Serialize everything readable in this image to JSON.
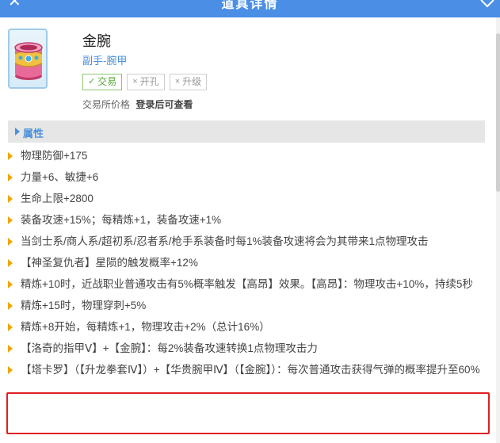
{
  "header": {
    "title": "道具详情",
    "close_icon": "close-icon",
    "favorite_icon": "heart-icon"
  },
  "item": {
    "name": "金腕",
    "category": "副手-腕甲",
    "icon": "bracer-item-icon",
    "tags": [
      {
        "label": "交易",
        "enabled": true
      },
      {
        "label": "开孔",
        "enabled": false
      },
      {
        "label": "升级",
        "enabled": false
      }
    ],
    "price_label": "交易所价格",
    "price_value": "登录后可查看"
  },
  "section": {
    "label": "属性"
  },
  "attributes": [
    "物理防御+175",
    "力量+6、敏捷+6",
    "生命上限+2800",
    "装备攻速+15%；每精炼+1，装备攻速+1%",
    "当剑士系/商人系/超初系/忍者系/枪手系装备时每1%装备攻速将会为其带来1点物理攻击",
    "【神圣复仇者】星陨的触发概率+12%",
    "精炼+10时，近战职业普通攻击有5%概率触发【高昂】效果。【高昂】：物理攻击+10%，持续5秒",
    "精炼+15时，物理穿刺+5%",
    "精炼+8开始，每精炼+1，物理攻击+2%（总计16%）",
    "【洛奇的指甲Ⅴ】+【金腕】：每2%装备攻速转换1点物理攻击力",
    "【塔卡罗】（【升龙拳套Ⅳ】）+【华贵腕甲Ⅳ】（【金腕】）：每次普通攻击获得气弹的概率提升至60%"
  ],
  "colors": {
    "header_bg": "#4a8ee6",
    "accent": "#4a90d9",
    "bullet": "#f0a500",
    "highlight_border": "#e02020",
    "tag_ok": "#5aa83a"
  }
}
